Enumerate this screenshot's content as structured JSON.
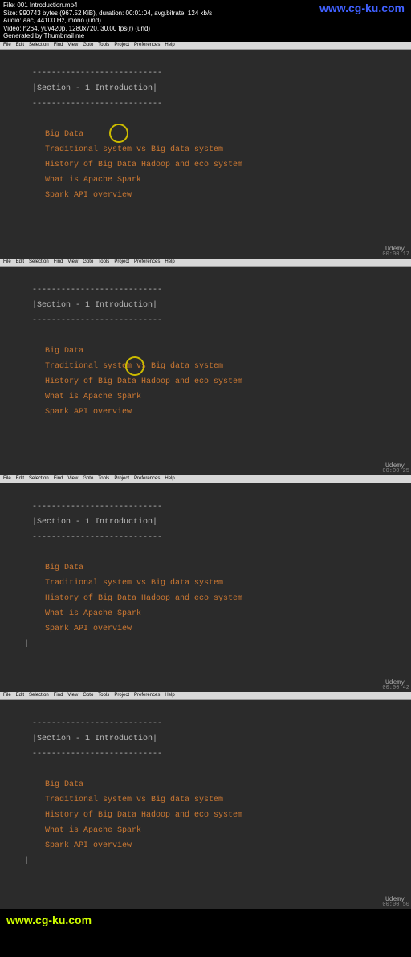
{
  "header": {
    "file": "File: 001 Introduction.mp4",
    "size": "Size: 990743 bytes (967.52 KiB), duration: 00:01:04, avg.bitrate: 124 kb/s",
    "audio": "Audio: aac, 44100 Hz, mono (und)",
    "video": "Video: h264, yuv420p, 1280x720, 30.00 fps(r) (und)",
    "generated": "Generated by Thumbnail me",
    "url": "www.cg-ku.com"
  },
  "menubar": [
    "File",
    "Edit",
    "Selection",
    "Find",
    "View",
    "Goto",
    "Tools",
    "Project",
    "Preferences",
    "Help"
  ],
  "editor": {
    "divider": "---------------------------",
    "section": "|Section - 1 Introduction|",
    "lines": [
      "Big Data",
      "Traditional system vs Big data system",
      "History of Big Data Hadoop and eco system",
      "What is Apache Spark",
      "Spark API overview"
    ]
  },
  "watermark": "Udemy",
  "timestamps": [
    "00:00:17",
    "00:00:25",
    "00:00:42",
    "00:00:50"
  ],
  "footer": {
    "url": "www.cg-ku.com"
  }
}
